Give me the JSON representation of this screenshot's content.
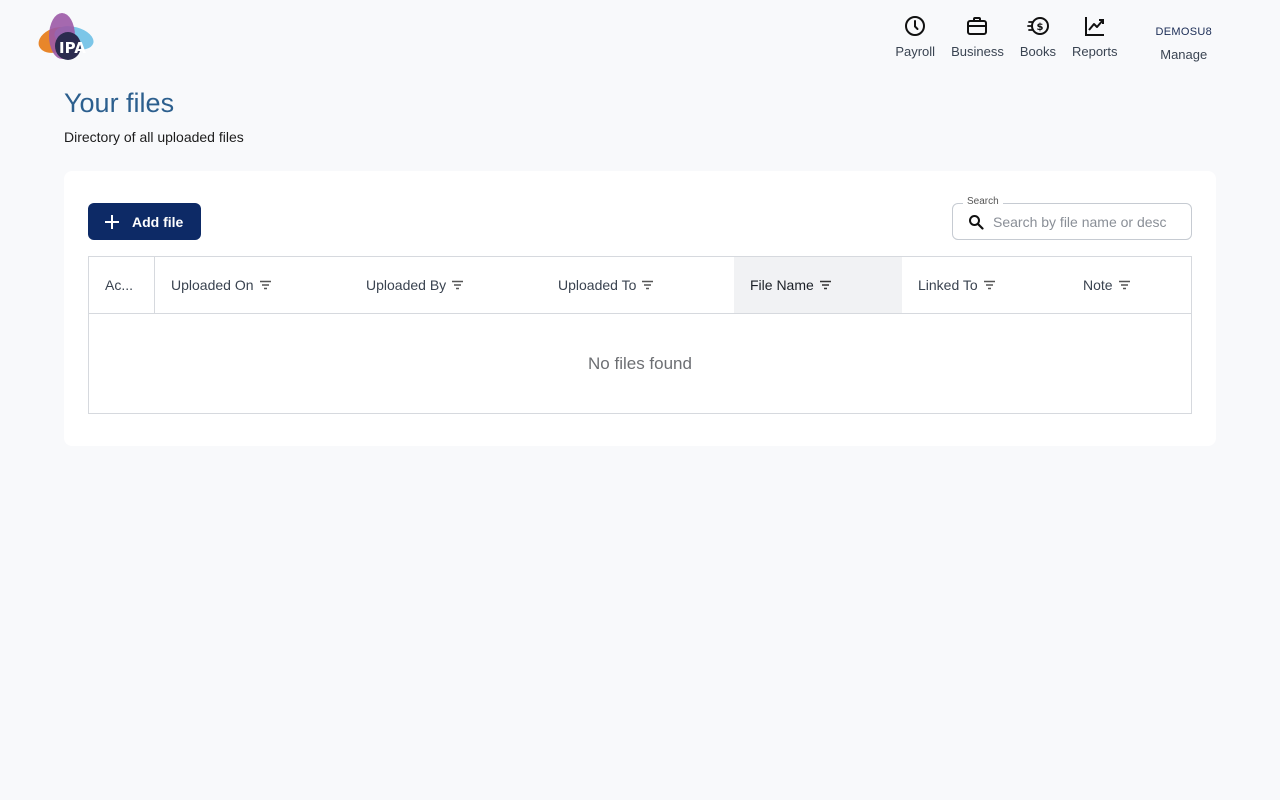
{
  "header": {
    "logo_text": "IPA",
    "nav": [
      {
        "label": "Payroll",
        "icon": "clock-icon"
      },
      {
        "label": "Business",
        "icon": "briefcase-icon"
      },
      {
        "label": "Books",
        "icon": "dollar-coin-icon"
      },
      {
        "label": "Reports",
        "icon": "line-chart-icon"
      }
    ],
    "user": {
      "username": "DEMOSU8",
      "label": "Manage"
    }
  },
  "page": {
    "title": "Your files",
    "subtitle": "Directory of all uploaded files"
  },
  "toolbar": {
    "add_label": "Add file",
    "search_label": "Search",
    "search_placeholder": "Search by file name or desc",
    "search_value": ""
  },
  "table": {
    "columns": [
      "Ac...",
      "Uploaded On",
      "Uploaded By",
      "Uploaded To",
      "File Name",
      "Linked To",
      "Note"
    ],
    "active_sort_column": "File Name",
    "rows": [],
    "empty_message": "No files found"
  },
  "colors": {
    "page_bg": "#f8f9fb",
    "title": "#2c5f8e",
    "primary_button": "#0d2a66",
    "active_column_bg": "#f1f2f4"
  }
}
